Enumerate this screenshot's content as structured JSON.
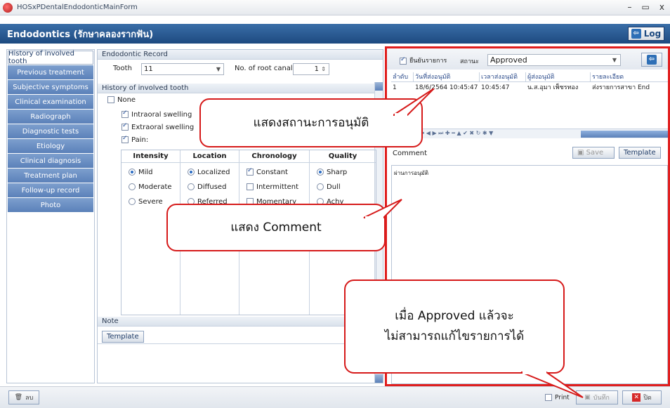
{
  "window": {
    "title": "HOSxPDentalEndodonticMainForm",
    "controls": [
      "–",
      "▭",
      "x"
    ]
  },
  "header": {
    "title": "Endodontics (รักษาคลองรากฟัน)",
    "log_label": "Log"
  },
  "sidebar": {
    "items": [
      {
        "label": "History of involved tooth"
      },
      {
        "label": "Previous treatment"
      },
      {
        "label": "Subjective symptoms"
      },
      {
        "label": "Clinical examination"
      },
      {
        "label": "Radiograph"
      },
      {
        "label": "Diagnostic tests"
      },
      {
        "label": "Etiology"
      },
      {
        "label": "Clinical diagnosis"
      },
      {
        "label": "Treatment plan"
      },
      {
        "label": "Follow-up record"
      },
      {
        "label": "Photo"
      }
    ]
  },
  "record": {
    "section_title": "Endodontic Record",
    "tooth_label": "Tooth",
    "tooth_value": "11",
    "root_label": "No. of root canal",
    "root_value": "1",
    "history_title": "History of involved tooth",
    "none_label": "None",
    "intraoral_label": "Intraoral swelling",
    "extraoral_label": "Extraoral swelling",
    "pain_label": "Pain:"
  },
  "pain_grid": {
    "headers": [
      "Intensity",
      "Location",
      "Chronology",
      "Quality"
    ],
    "intensity": [
      "Mild",
      "Moderate",
      "Severe"
    ],
    "location": [
      "Localized",
      "Diffused",
      "Referred"
    ],
    "chronology": [
      "Constant",
      "Intermittent",
      "Momentary"
    ],
    "quality": [
      "Sharp",
      "Dull",
      "Achy"
    ]
  },
  "note": {
    "title": "Note",
    "template_label": "Template"
  },
  "approval": {
    "confirm_label": "ยืนยันรายการ",
    "status_label": "สถานะ",
    "status_value": "Approved",
    "columns": [
      "ลำดับ",
      "วันที่ส่งอนุมัติ",
      "เวลาส่งอนุมัติ",
      "ผู้ส่งอนุมัติ",
      "รายละเอียด"
    ],
    "rows": [
      [
        "1",
        "18/6/2564 10:45:47",
        "10:45:47",
        "น.ส.อุมา เพ็ชรทอง",
        "ส่งรายการสาขา End"
      ]
    ],
    "nav_symbols": "⏮ ◀ ▶ ⏭ ✚ ━ ▲ ✔ ✖ ↻ ✱ ▼"
  },
  "comment": {
    "title": "Comment",
    "save_label": "Save",
    "template_label": "Template",
    "text": "ผ่านการอนุมัติ"
  },
  "bottom": {
    "delete_label": "ลบ",
    "print_label": "Print",
    "save_label": "บันทึก",
    "close_label": "ปิด"
  },
  "callouts": {
    "status": "แสดงสถานะการอนุมัติ",
    "comment": "แสดง Comment",
    "approved_line1": "เมื่อ Approved แล้วจะ",
    "approved_line2": "ไม่สามารถแก้ไขรายการได้"
  },
  "colors": {
    "header": "#2a5b95",
    "sidebar": "#6a8ec4",
    "callout_border": "#d61a1a",
    "highlight": "#e01e1e"
  }
}
